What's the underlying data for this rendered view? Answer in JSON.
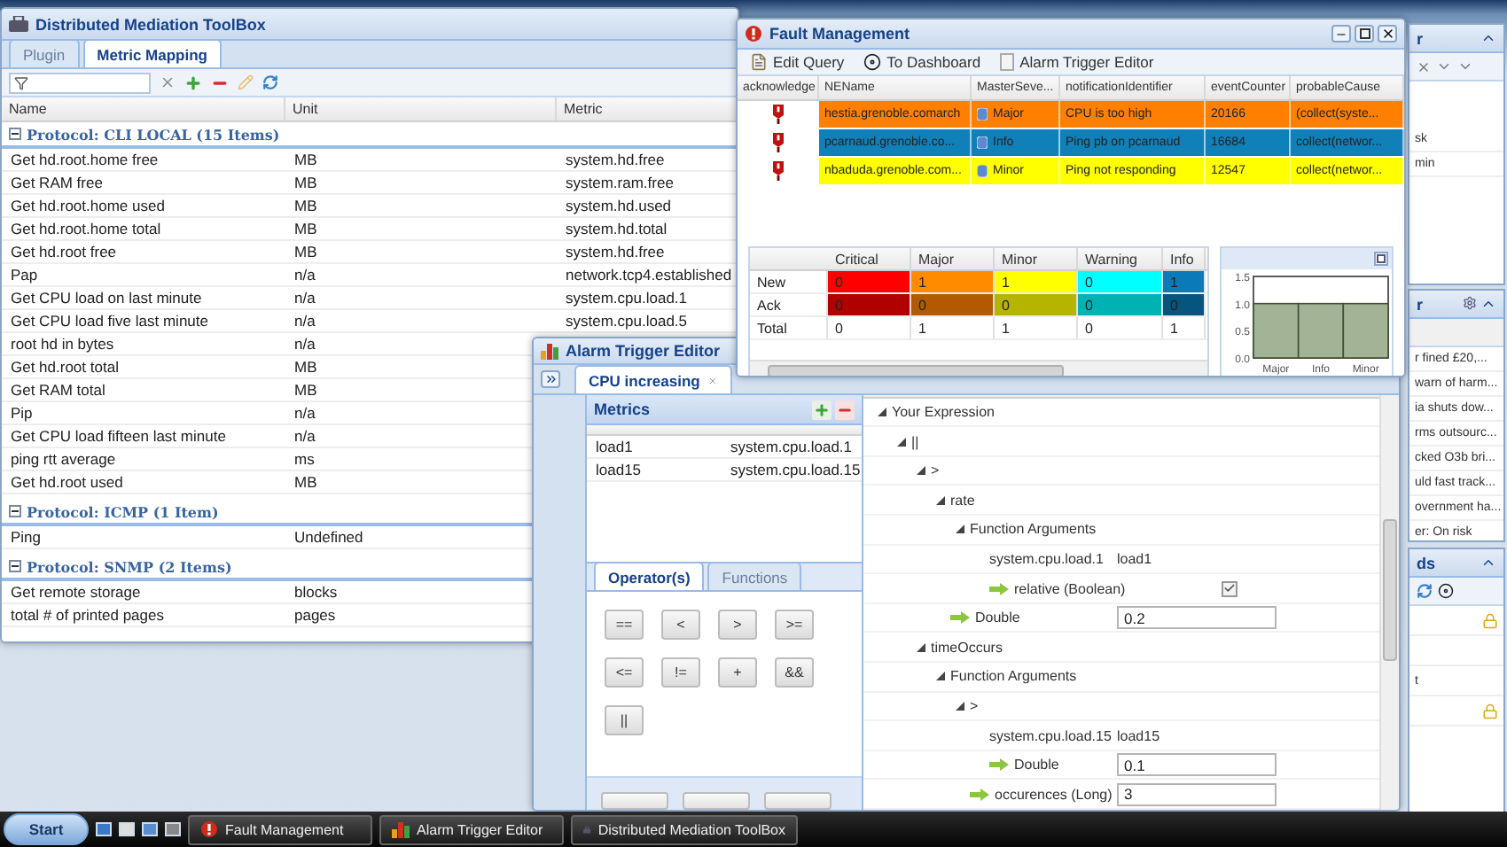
{
  "toolbox": {
    "title": "Distributed Mediation ToolBox",
    "tabs": [
      {
        "label": "Plugin",
        "selected": false
      },
      {
        "label": "Metric Mapping",
        "selected": true
      }
    ],
    "columns": [
      "Name",
      "Unit",
      "Metric"
    ],
    "groups": [
      {
        "label": "Protocol: CLI LOCAL (15 Items)",
        "expanded": true,
        "rows": [
          {
            "name": "Get hd.root.home free",
            "unit": "MB",
            "metric": "system.hd.free"
          },
          {
            "name": "Get RAM free",
            "unit": "MB",
            "metric": "system.ram.free"
          },
          {
            "name": "Get hd.root.home used",
            "unit": "MB",
            "metric": "system.hd.used"
          },
          {
            "name": "Get hd.root.home total",
            "unit": "MB",
            "metric": "system.hd.total"
          },
          {
            "name": "Get hd.root free",
            "unit": "MB",
            "metric": "system.hd.free"
          },
          {
            "name": "Pap",
            "unit": "n/a",
            "metric": "network.tcp4.established"
          },
          {
            "name": "Get CPU load on last minute",
            "unit": "n/a",
            "metric": "system.cpu.load.1"
          },
          {
            "name": "Get CPU load five last minute",
            "unit": "n/a",
            "metric": "system.cpu.load.5"
          },
          {
            "name": "root hd in bytes",
            "unit": "n/a"
          },
          {
            "name": "Get hd.root total",
            "unit": "MB"
          },
          {
            "name": "Get RAM total",
            "unit": "MB"
          },
          {
            "name": "Pip",
            "unit": "n/a"
          },
          {
            "name": "Get CPU load fifteen last minute",
            "unit": "n/a"
          },
          {
            "name": "ping rtt average",
            "unit": "ms"
          },
          {
            "name": "Get hd.root used",
            "unit": "MB"
          }
        ]
      },
      {
        "label": "Protocol: ICMP (1 Item)",
        "expanded": true,
        "rows": [
          {
            "name": "Ping",
            "unit": "Undefined"
          }
        ]
      },
      {
        "label": "Protocol: SNMP (2 Items)",
        "expanded": true,
        "rows": [
          {
            "name": "Get remote storage",
            "unit": "blocks"
          },
          {
            "name": "total # of printed pages",
            "unit": "pages"
          }
        ]
      }
    ]
  },
  "fault": {
    "title": "Fault Management",
    "toolbar": [
      {
        "label": "Edit Query",
        "kind": "edit"
      },
      {
        "label": "To Dashboard",
        "kind": "dashboard"
      },
      {
        "label": "Alarm Trigger Editor",
        "kind": "alarm"
      }
    ],
    "columns": [
      "acknowledge",
      "NEName",
      "MasterSeve...",
      "notificationIdentifier",
      "eventCounter",
      "probableCause"
    ],
    "rows": [
      {
        "ne_name": "hestia.grenoble.comarch",
        "severity": "Major",
        "notification": "CPU is too high",
        "event_counter": "20166",
        "probable_cause": "(collect(syste...",
        "color": "#ff8000"
      },
      {
        "ne_name": "pcarnaud.grenoble.co...",
        "severity": "Info",
        "notification": "Ping pb on pcarnaud",
        "event_counter": "16684",
        "probable_cause": "collect(networ...",
        "color": "#1080b8"
      },
      {
        "ne_name": "nbaduda.grenoble.com...",
        "severity": "Minor",
        "notification": "Ping not responding",
        "event_counter": "12547",
        "probable_cause": "collect(networ...",
        "color": "#ffff00"
      }
    ],
    "summary": {
      "columns": [
        "Critical",
        "Major",
        "Minor",
        "Warning",
        "Info"
      ],
      "rows": [
        {
          "label": "New",
          "cells": [
            {
              "value": "0",
              "color": "#ff0000"
            },
            {
              "value": "1",
              "color": "#ff8c00"
            },
            {
              "value": "1",
              "color": "#ffff00"
            },
            {
              "value": "0",
              "color": "#00ffff"
            },
            {
              "value": "1",
              "color": "#0a7ab8"
            }
          ]
        },
        {
          "label": "Ack",
          "cells": [
            {
              "value": "0",
              "color": "#b00000"
            },
            {
              "value": "0",
              "color": "#b35a00"
            },
            {
              "value": "0",
              "color": "#b5b500"
            },
            {
              "value": "0",
              "color": "#00b3b3"
            },
            {
              "value": "0",
              "color": "#06557f"
            }
          ]
        },
        {
          "label": "Total",
          "cells": [
            {
              "value": "0"
            },
            {
              "value": "1"
            },
            {
              "value": "1"
            },
            {
              "value": "0"
            },
            {
              "value": "1"
            }
          ]
        }
      ]
    },
    "chart_data": {
      "type": "bar",
      "categories": [
        "Major",
        "Info",
        "Minor"
      ],
      "values": [
        1,
        1,
        1
      ],
      "color": "#a3b396",
      "ylim": [
        0,
        1.5
      ],
      "yticks": [
        {
          "value": 0,
          "label": "0.0"
        },
        {
          "value": 0.5,
          "label": "0.5"
        },
        {
          "value": 1,
          "label": "1.0"
        },
        {
          "value": 1.5,
          "label": "1.5"
        }
      ]
    }
  },
  "alarm_editor": {
    "title": "Alarm Trigger Editor",
    "tabs": [
      {
        "label": "CPU increasing",
        "selected": true
      }
    ],
    "metrics": {
      "title": "Metrics",
      "rows": [
        {
          "name": "load1",
          "metric": "system.cpu.load.1"
        },
        {
          "name": "load15",
          "metric": "system.cpu.load.15"
        }
      ]
    },
    "operator_tabs": [
      {
        "label": "Operator(s)",
        "selected": true
      },
      {
        "label": "Functions",
        "selected": false
      }
    ],
    "operators": [
      "==",
      "<",
      ">",
      ">=",
      "<=",
      "!=",
      "+",
      "&&",
      "||"
    ],
    "tree": [
      {
        "kind": "node",
        "label": "Your Expression",
        "expanded": true,
        "children": [
          {
            "kind": "node",
            "label": "||",
            "expanded": true,
            "children": [
              {
                "kind": "node",
                "label": ">",
                "expanded": true,
                "children": [
                  {
                    "kind": "node",
                    "label": "rate",
                    "expanded": true,
                    "children": [
                      {
                        "kind": "node",
                        "label": "Function Arguments",
                        "expanded": true,
                        "children": [
                          {
                            "kind": "pair",
                            "label": "system.cpu.load.1",
                            "value": "load1"
                          },
                          {
                            "kind": "checkbox",
                            "label": "relative (Boolean)",
                            "checked": true
                          }
                        ]
                      }
                    ]
                  },
                  {
                    "kind": "field",
                    "label": "Double",
                    "value": "0.2"
                  }
                ]
              },
              {
                "kind": "node",
                "label": "timeOccurs",
                "expanded": true,
                "children": [
                  {
                    "kind": "node",
                    "label": "Function Arguments",
                    "expanded": true,
                    "children": [
                      {
                        "kind": "node",
                        "label": ">",
                        "expanded": true,
                        "children": [
                          {
                            "kind": "pair",
                            "label": "system.cpu.load.15",
                            "value": "load15"
                          },
                          {
                            "kind": "field",
                            "label": "Double",
                            "value": "0.1"
                          }
                        ]
                      },
                      {
                        "kind": "field",
                        "label": "occurences (Long)",
                        "value": "3"
                      }
                    ]
                  }
                ]
              }
            ]
          }
        ]
      }
    ]
  },
  "side_panels": [
    {
      "kind": "filter",
      "title": "r",
      "rows": [
        {
          "text": "sk"
        },
        {
          "text": "min"
        }
      ]
    },
    {
      "kind": "news",
      "title": "r",
      "rows": [
        {
          "text": "r fined £20,..."
        },
        {
          "text": "warn of harm..."
        },
        {
          "text": "ia shuts dow..."
        },
        {
          "text": "rms outsourc..."
        },
        {
          "text": "cked O3b bri..."
        },
        {
          "text": "uld fast track..."
        },
        {
          "text": "overnment ha..."
        },
        {
          "text": "er: On risk"
        }
      ]
    },
    {
      "kind": "tools",
      "title": "ds",
      "rows": [
        {
          "locked": true
        },
        {
          "locked": false
        },
        {
          "text": "t",
          "locked": false
        },
        {
          "locked": true
        }
      ]
    }
  ],
  "taskbar": {
    "start": "Start",
    "tasks": [
      {
        "label": "Fault Management",
        "kind": "fault"
      },
      {
        "label": "Alarm Trigger Editor",
        "kind": "alarm"
      },
      {
        "label": "Distributed Mediation ToolBox",
        "kind": "toolbox"
      }
    ]
  }
}
